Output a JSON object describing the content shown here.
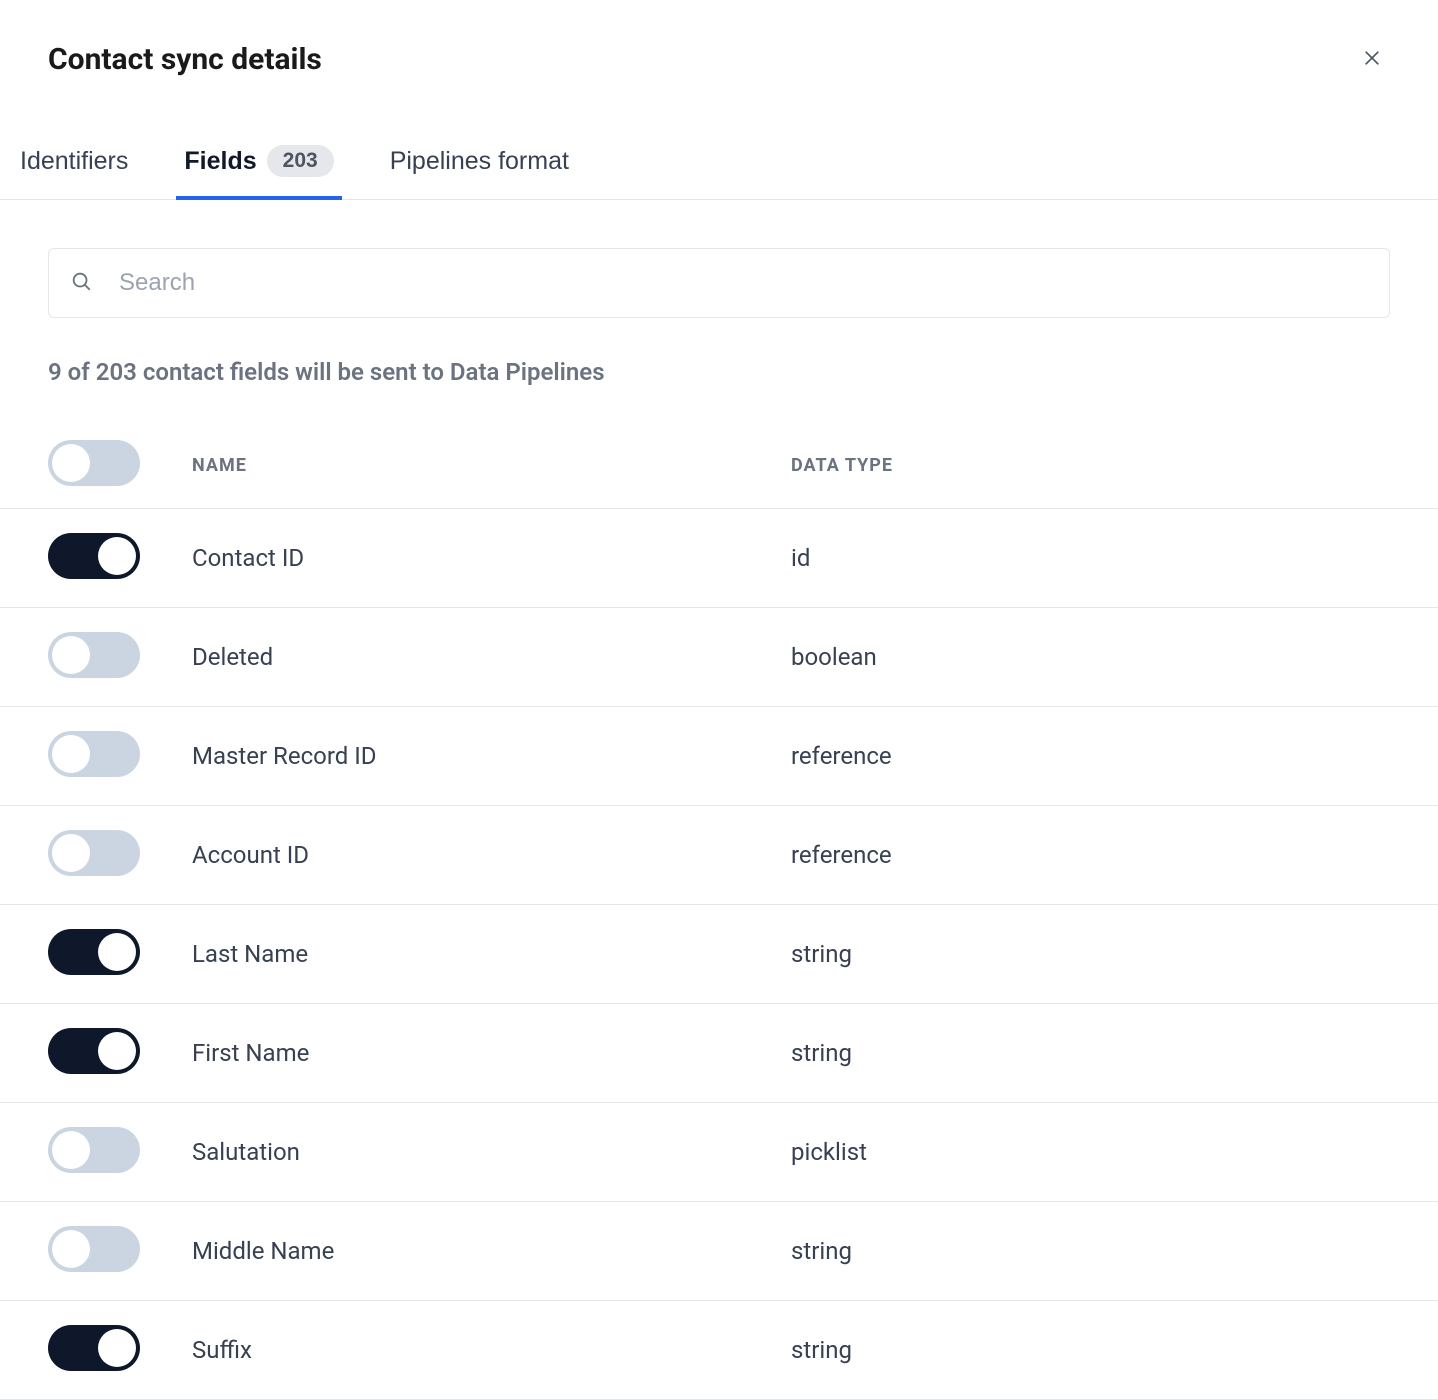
{
  "header": {
    "title": "Contact sync details"
  },
  "tabs": {
    "identifiers": "Identifiers",
    "fields": "Fields",
    "fields_count": "203",
    "pipelines_format": "Pipelines format"
  },
  "search": {
    "placeholder": "Search"
  },
  "status": "9 of 203 contact fields will be sent to Data Pipelines",
  "columns": {
    "name": "NAME",
    "data_type": "DATA TYPE"
  },
  "fields": [
    {
      "enabled": true,
      "name": "Contact ID",
      "type": "id"
    },
    {
      "enabled": false,
      "name": "Deleted",
      "type": "boolean"
    },
    {
      "enabled": false,
      "name": "Master Record ID",
      "type": "reference"
    },
    {
      "enabled": false,
      "name": "Account ID",
      "type": "reference"
    },
    {
      "enabled": true,
      "name": "Last Name",
      "type": "string"
    },
    {
      "enabled": true,
      "name": "First Name",
      "type": "string"
    },
    {
      "enabled": false,
      "name": "Salutation",
      "type": "picklist"
    },
    {
      "enabled": false,
      "name": "Middle Name",
      "type": "string"
    },
    {
      "enabled": true,
      "name": "Suffix",
      "type": "string"
    }
  ]
}
